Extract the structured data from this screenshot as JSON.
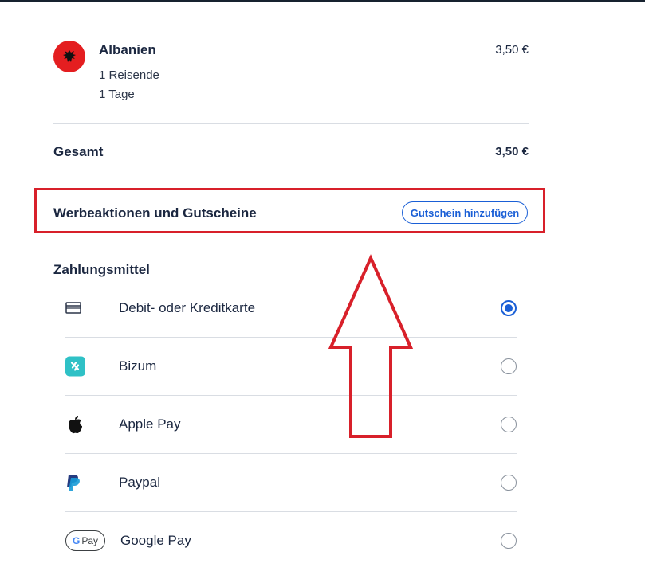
{
  "item": {
    "country": "Albanien",
    "travelers": "1 Reisende",
    "days": "1 Tage",
    "price": "3,50 €"
  },
  "total": {
    "label": "Gesamt",
    "value": "3,50 €"
  },
  "promo": {
    "label": "Werbeaktionen und Gutscheine",
    "button": "Gutschein hinzufügen"
  },
  "payment": {
    "title": "Zahlungsmittel",
    "methods": [
      {
        "label": "Debit- oder Kreditkarte",
        "icon": "credit-card-icon",
        "selected": true
      },
      {
        "label": "Bizum",
        "icon": "bizum-icon",
        "selected": false
      },
      {
        "label": "Apple Pay",
        "icon": "apple-icon",
        "selected": false
      },
      {
        "label": "Paypal",
        "icon": "paypal-icon",
        "selected": false
      },
      {
        "label": "Google Pay",
        "icon": "google-pay-icon",
        "selected": false
      }
    ]
  },
  "colors": {
    "accent": "#1a5fd6",
    "highlight": "#d8202a",
    "text": "#1b2740"
  },
  "google_pay_badge": "Pay"
}
